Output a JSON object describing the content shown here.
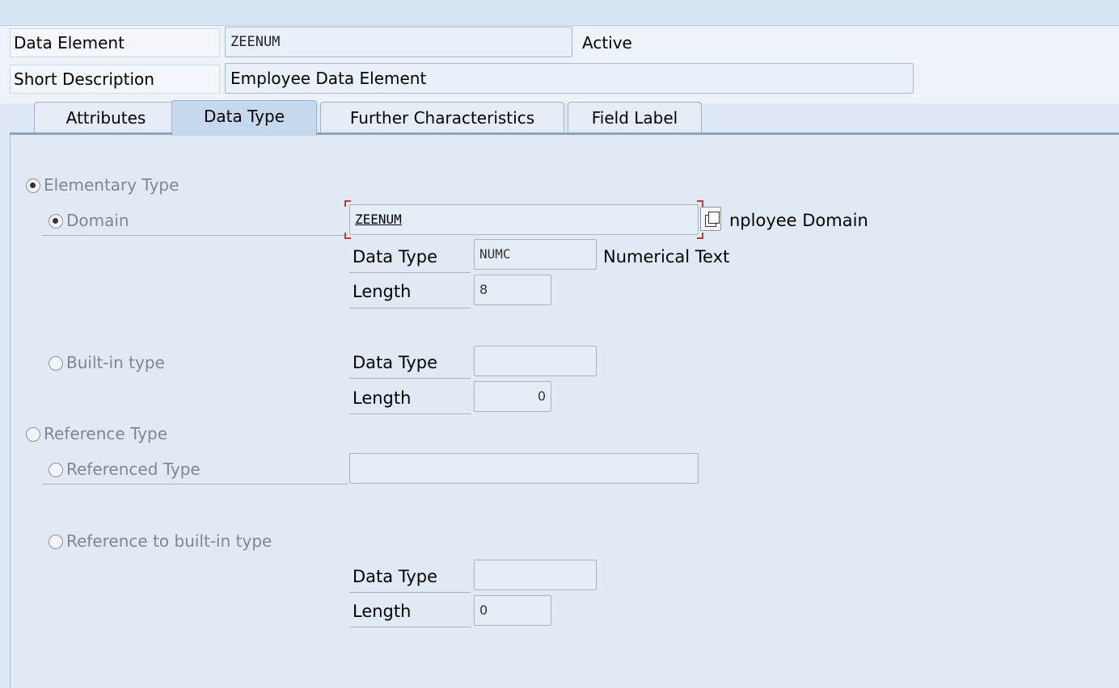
{
  "header": {
    "data_element_label": "Data Element",
    "data_element_value": "ZEENUM",
    "status": "Active",
    "short_desc_label": "Short Description",
    "short_desc_value": "Employee Data Element"
  },
  "tabs": [
    {
      "label": "Attributes",
      "active": false
    },
    {
      "label": "Data Type",
      "active": true
    },
    {
      "label": "Further Characteristics",
      "active": false
    },
    {
      "label": "Field Label",
      "active": false
    }
  ],
  "data_type_tab": {
    "elementary_type_label": "Elementary Type",
    "domain_label": "Domain",
    "domain_value": "ZEENUM",
    "domain_description": "nployee Domain",
    "domain_data_type_label": "Data Type",
    "domain_data_type_value": "NUMC",
    "domain_data_type_desc": "Numerical Text",
    "domain_length_label": "Length",
    "domain_length_value": "8",
    "builtin_label": "Built-in type",
    "builtin_data_type_label": "Data Type",
    "builtin_data_type_value": "",
    "builtin_length_label": "Length",
    "builtin_length_value": "0",
    "reference_type_label": "Reference Type",
    "referenced_type_label": "Referenced Type",
    "referenced_type_value": "",
    "ref_builtin_label": "Reference to built-in type",
    "ref_builtin_data_type_label": "Data Type",
    "ref_builtin_data_type_value": "",
    "ref_builtin_length_label": "Length",
    "ref_builtin_length_value": "0"
  },
  "icons": {
    "value_help": "value-help-icon"
  }
}
